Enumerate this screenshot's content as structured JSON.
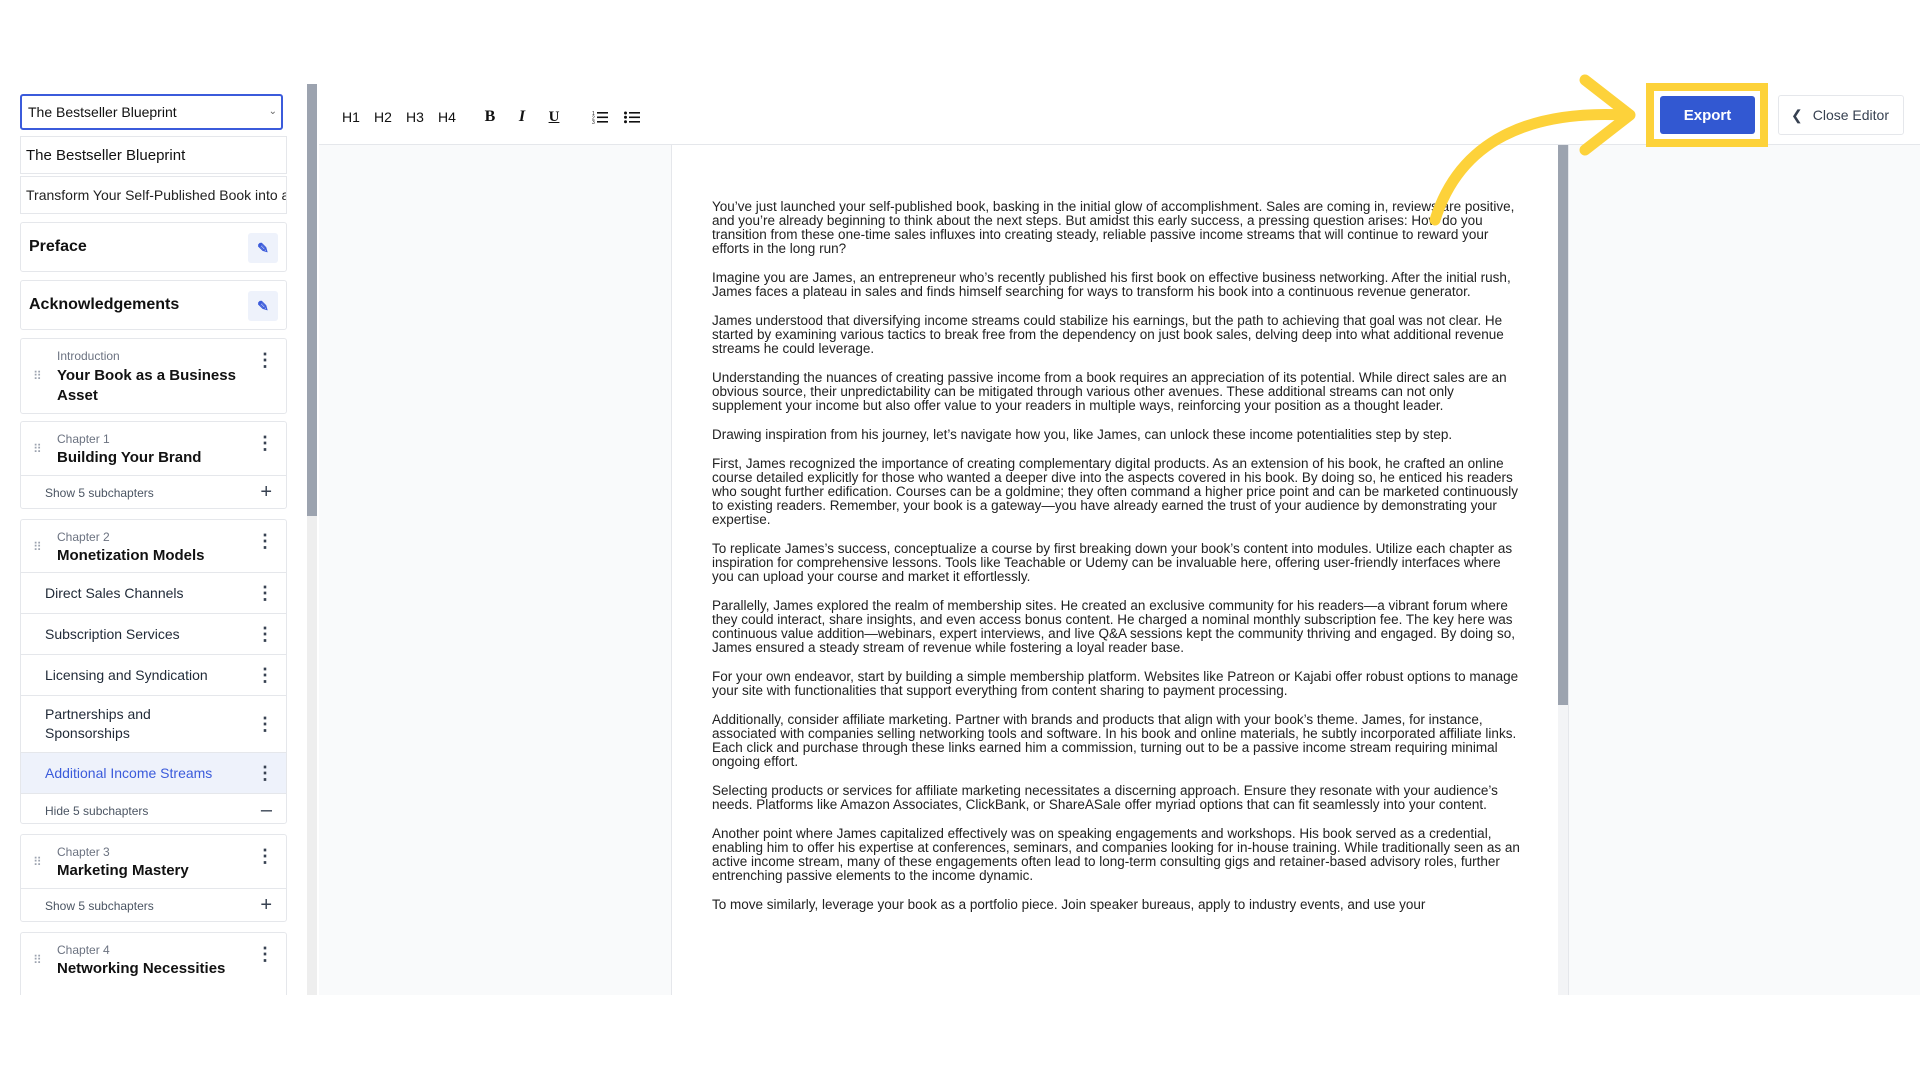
{
  "book_select": {
    "value": "The Bestseller Blueprint"
  },
  "book_title": "The Bestseller Blueprint",
  "book_subtitle": "Transform Your Self-Published Book into a Business",
  "sidebar": {
    "preface": "Preface",
    "acknowledgements": "Acknowledgements",
    "intro": {
      "kicker": "Introduction",
      "title": "Your Book as a Business Asset"
    },
    "ch1": {
      "kicker": "Chapter 1",
      "title": "Building Your Brand",
      "toggle": "Show 5 subchapters"
    },
    "ch2": {
      "kicker": "Chapter 2",
      "title": "Monetization Models",
      "subs": [
        "Direct Sales Channels",
        "Subscription Services",
        "Licensing and Syndication",
        "Partnerships and Sponsorships",
        "Additional Income Streams"
      ],
      "toggle": "Hide 5 subchapters"
    },
    "ch3": {
      "kicker": "Chapter 3",
      "title": "Marketing Mastery",
      "toggle": "Show 5 subchapters"
    },
    "ch4": {
      "kicker": "Chapter 4",
      "title": "Networking Necessities"
    }
  },
  "toolbar": {
    "h1": "H1",
    "h2": "H2",
    "h3": "H3",
    "h4": "H4",
    "bold": "B",
    "italic": "I",
    "underline": "U",
    "ordered_list_icon": "ordered-list-icon",
    "bullet_list_icon": "bullet-list-icon"
  },
  "export_label": "Export",
  "close_editor_label": "Close Editor",
  "colors": {
    "accent": "#3258d2",
    "highlight": "#fdd23a",
    "active_bg": "#eef2fb"
  },
  "document": {
    "paragraphs": [
      "You’ve just launched your self-published book, basking in the initial glow of accomplishment. Sales are coming in, reviews are positive, and you’re already beginning to think about the next steps. But amidst this early success, a pressing question arises: How do you transition from these one-time sales influxes into creating steady, reliable passive income streams that will continue to reward your efforts in the long run?",
      "Imagine you are James, an entrepreneur who’s recently published his first book on effective business networking. After the initial rush, James faces a plateau in sales and finds himself searching for ways to transform his book into a continuous revenue generator.",
      "James understood that diversifying income streams could stabilize his earnings, but the path to achieving that goal was not clear. He started by examining various tactics to break free from the dependency on just book sales, delving deep into what additional revenue streams he could leverage.",
      "Understanding the nuances of creating passive income from a book requires an appreciation of its potential. While direct sales are an obvious source, their unpredictability can be mitigated through various other avenues. These additional streams can not only supplement your income but also offer value to your readers in multiple ways, reinforcing your position as a thought leader.",
      "Drawing inspiration from his journey, let’s navigate how you, like James, can unlock these income potentialities step by step.",
      "First, James recognized the importance of creating complementary digital products. As an extension of his book, he crafted an online course detailed explicitly for those who wanted a deeper dive into the aspects covered in his book. By doing so, he enticed his readers who sought further edification. Courses can be a goldmine; they often command a higher price point and can be marketed continuously to existing readers. Remember, your book is a gateway—you have already earned the trust of your audience by demonstrating your expertise.",
      "To replicate James’s success, conceptualize a course by first breaking down your book’s content into modules. Utilize each chapter as inspiration for comprehensive lessons. Tools like Teachable or Udemy can be invaluable here, offering user-friendly interfaces where you can upload your course and market it effortlessly.",
      "Parallelly, James explored the realm of membership sites. He created an exclusive community for his readers—a vibrant forum where they could interact, share insights, and even access bonus content. He charged a nominal monthly subscription fee. The key here was continuous value addition—webinars, expert interviews, and live Q&A sessions kept the community thriving and engaged. By doing so, James ensured a steady stream of revenue while fostering a loyal reader base.",
      "For your own endeavor, start by building a simple membership platform. Websites like Patreon or Kajabi offer robust options to manage your site with functionalities that support everything from content sharing to payment processing.",
      "Additionally, consider affiliate marketing. Partner with brands and products that align with your book’s theme. James, for instance, associated with companies selling networking tools and software. In his book and online materials, he subtly incorporated affiliate links. Each click and purchase through these links earned him a commission, turning out to be a passive income stream requiring minimal ongoing effort.",
      "Selecting products or services for affiliate marketing necessitates a discerning approach. Ensure they resonate with your audience’s needs. Platforms like Amazon Associates, ClickBank, or ShareASale offer myriad options that can fit seamlessly into your content.",
      "Another point where James capitalized effectively was on speaking engagements and workshops. His book served as a credential, enabling him to offer his expertise at conferences, seminars, and companies looking for in-house training. While traditionally seen as an active income stream, many of these engagements often lead to long-term consulting gigs and retainer-based advisory roles, further entrenching passive elements to the income dynamic.",
      "To move similarly, leverage your book as a portfolio piece. Join speaker bureaus, apply to industry events, and use your"
    ]
  }
}
